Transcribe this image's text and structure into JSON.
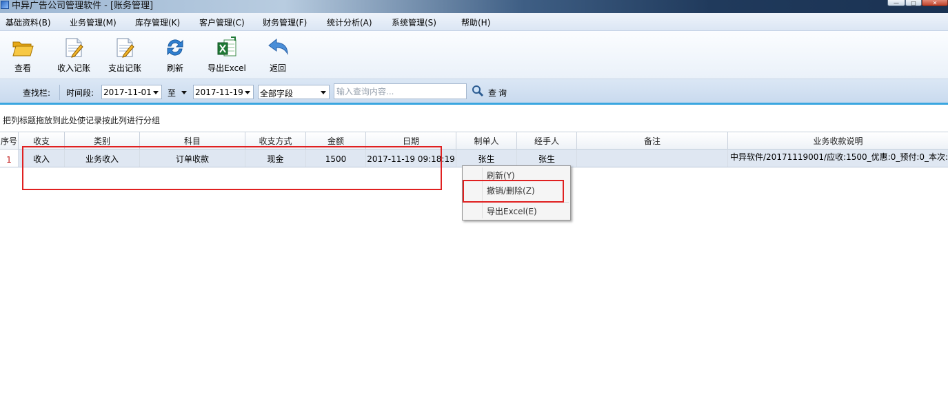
{
  "window": {
    "title": "中异广告公司管理软件 - [账务管理]",
    "minimize": "—",
    "maximize": "□",
    "close": "✕"
  },
  "menu": [
    {
      "label": "基础资料(B)"
    },
    {
      "label": "业务管理(M)"
    },
    {
      "label": "库存管理(K)"
    },
    {
      "label": "客户管理(C)"
    },
    {
      "label": "财务管理(F)"
    },
    {
      "label": "统计分析(A)"
    },
    {
      "label": "系统管理(S)"
    },
    {
      "label": "帮助(H)"
    }
  ],
  "toolbar": {
    "view": "查看",
    "income": "收入记账",
    "expense": "支出记账",
    "refresh": "刷新",
    "export": "导出Excel",
    "back": "返回"
  },
  "search": {
    "label": "查找栏:",
    "period_label": "时间段:",
    "date_from": "2017-11-01",
    "to_label": "至",
    "date_to": "2017-11-19",
    "field": "全部字段",
    "placeholder": "输入查询内容...",
    "button": "查询"
  },
  "group_hint": "把列标题拖放到此处使记录按此列进行分组",
  "grid": {
    "columns": [
      "序号",
      "收支",
      "类别",
      "科目",
      "收支方式",
      "金额",
      "日期",
      "制单人",
      "经手人",
      "备注",
      "业务收款说明"
    ],
    "rows": [
      {
        "no": "1",
        "type": "收入",
        "category": "业务收入",
        "subject": "订单收款",
        "method": "现金",
        "amount": "1500",
        "date": "2017-11-19 09:18:19",
        "maker": "张生",
        "handler": "张生",
        "remark": "",
        "desc": "中异软件/20171119001/应收:1500_优惠:0_预付:0_本次:"
      }
    ]
  },
  "context_menu": {
    "refresh": "刷新(Y)",
    "undo_delete": "撤销/删除(Z)",
    "export": "导出Excel(E)"
  },
  "colors": {
    "highlight": "#e02020",
    "accent": "#3aa6e0",
    "row_number": "#c01818"
  }
}
